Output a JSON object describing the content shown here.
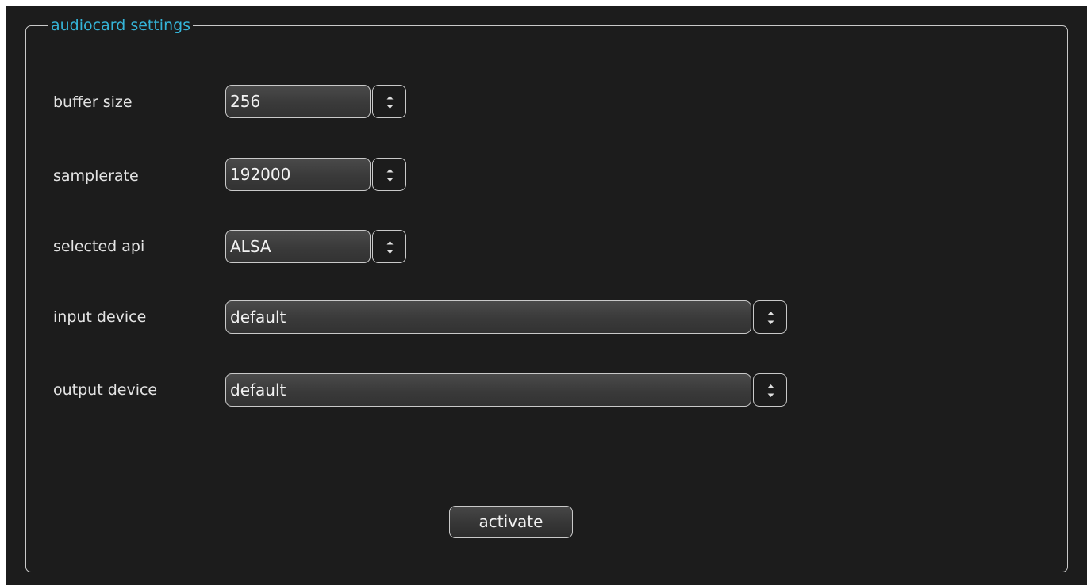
{
  "group": {
    "title": "audiocard settings"
  },
  "fields": {
    "buffer_size": {
      "label": "buffer size",
      "value": "256"
    },
    "samplerate": {
      "label": "samplerate",
      "value": "192000"
    },
    "selected_api": {
      "label": "selected api",
      "value": "ALSA"
    },
    "input_device": {
      "label": "input device",
      "value": "default"
    },
    "output_device": {
      "label": "output device",
      "value": "default"
    }
  },
  "actions": {
    "activate_label": "activate"
  },
  "colors": {
    "background": "#1c1c1c",
    "accent": "#35b4d8",
    "border": "#c9c9c9",
    "text": "#e4e4e4"
  },
  "icons": {
    "spinner": "spin-up-down-icon"
  }
}
